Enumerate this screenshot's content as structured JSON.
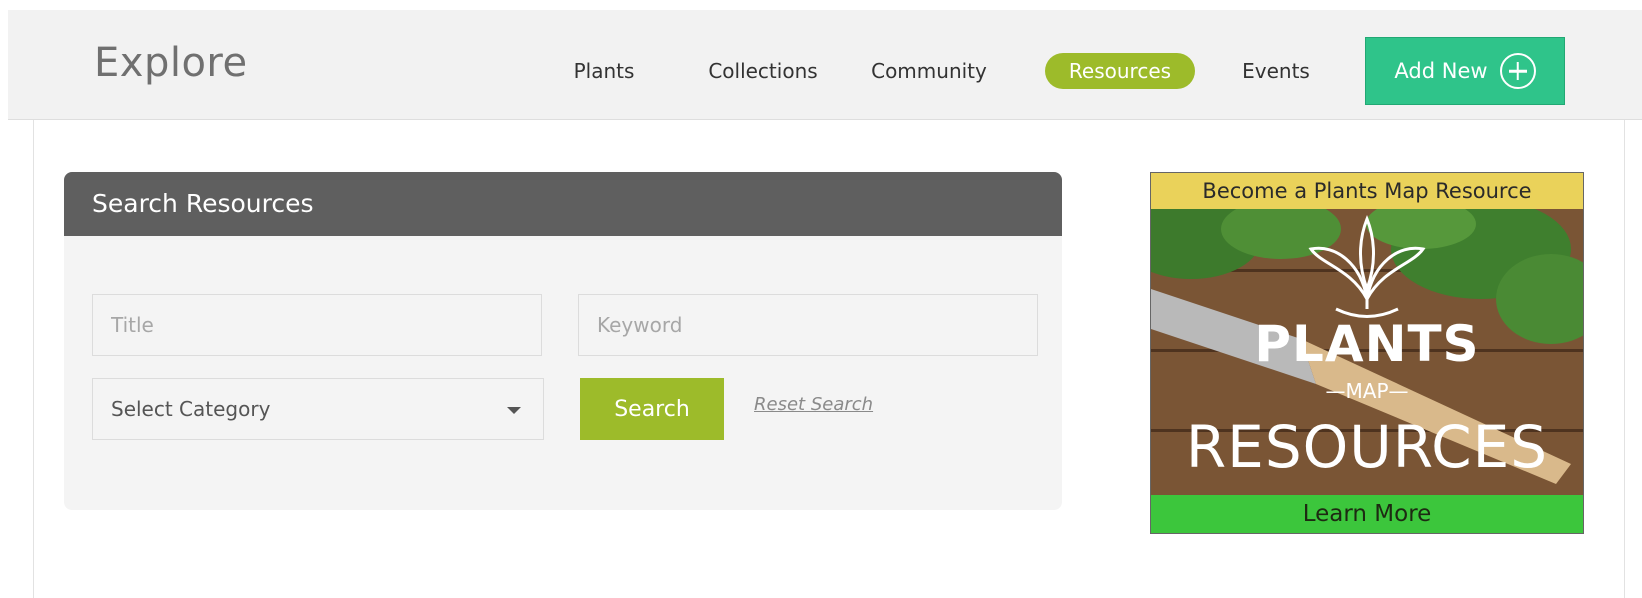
{
  "header": {
    "brand": "Explore",
    "nav": [
      "Plants",
      "Collections",
      "Community",
      "Resources",
      "Events"
    ],
    "active_nav": "Resources",
    "add_button": "Add New",
    "colors": {
      "background": "#f2f2f2",
      "active": "#9dbb2a",
      "add": "#2fc48a"
    }
  },
  "search_panel": {
    "title": "Search Resources",
    "title_placeholder": "Title",
    "keyword_placeholder": "Keyword",
    "category_selected": "Select Category",
    "search_button": "Search",
    "reset_link": "Reset Search",
    "colors": {
      "header": "#5f5f5f",
      "button": "#9dbb2a"
    }
  },
  "ad": {
    "top_text": "Become a Plants Map Resource",
    "logo_plants": "PLANTS",
    "logo_map": "—MAP—",
    "logo_resources": "RESOURCES",
    "bottom_text": "Learn More",
    "colors": {
      "top": "#ead25a",
      "bottom": "#3cc63c"
    }
  }
}
